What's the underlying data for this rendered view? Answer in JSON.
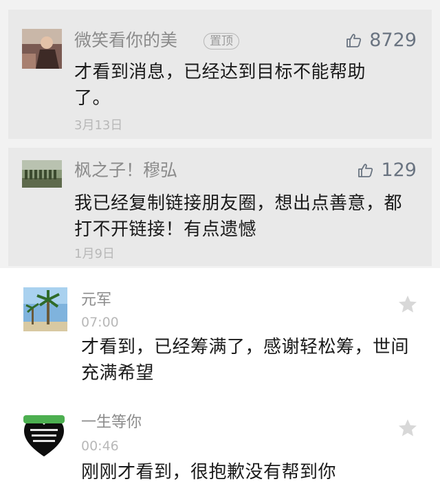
{
  "comments_pinned": [
    {
      "name": "微笑看你的美",
      "badge": "置顶",
      "likes": "8729",
      "text": "才看到消息，已经达到目标不能帮助了。",
      "date": "3月13日"
    },
    {
      "name": "枫之子！穆弘",
      "likes": "129",
      "text": "我已经复制链接朋友圈，想出点善意，都打不开链接！有点遗憾",
      "date": "1月9日"
    }
  ],
  "comments": [
    {
      "name": "元军",
      "time": "07:00",
      "text": "才看到，已经筹满了，感谢轻松筹，世间充满希望"
    },
    {
      "name": "一生等你",
      "time": "00:46",
      "text": "刚刚才看到，很抱歉没有帮到你"
    }
  ],
  "icons": {
    "like": "thumbs-up-icon",
    "star": "star-icon"
  },
  "colors": {
    "pinned_bg": "#e9e9e9",
    "like_color": "#6a7481",
    "name_color": "#8b8b8b",
    "date_color": "#b8b8b8"
  }
}
